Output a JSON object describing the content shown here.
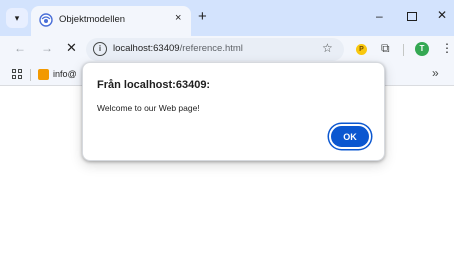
{
  "browser": {
    "tab": {
      "title": "Objektmodellen",
      "close_glyph": "×"
    },
    "new_tab_glyph": "+",
    "tab_menu_glyph": "▾",
    "window_controls": {
      "minimize": "–",
      "close": "✕"
    },
    "nav": {
      "back": "←",
      "forward": "→",
      "stop": "✕"
    },
    "address": {
      "host": "localhost:63409",
      "path": "/reference.html"
    },
    "star_glyph": "☆",
    "extension_badge": "P",
    "puzzle_glyph": "⧉",
    "profile_initial": "T",
    "menu_glyph": "⋮",
    "bookmarks": {
      "items": [
        {
          "label": "info@"
        }
      ],
      "overflow_glyph": "»"
    }
  },
  "dialog": {
    "title": "Från localhost:63409:",
    "message": "Welcome to our Web page!",
    "ok_label": "OK"
  },
  "colors": {
    "accent": "#0b57d0",
    "tabstrip": "#d3e3fd",
    "toolbar": "#f3f6fc",
    "profile": "#34a853"
  }
}
